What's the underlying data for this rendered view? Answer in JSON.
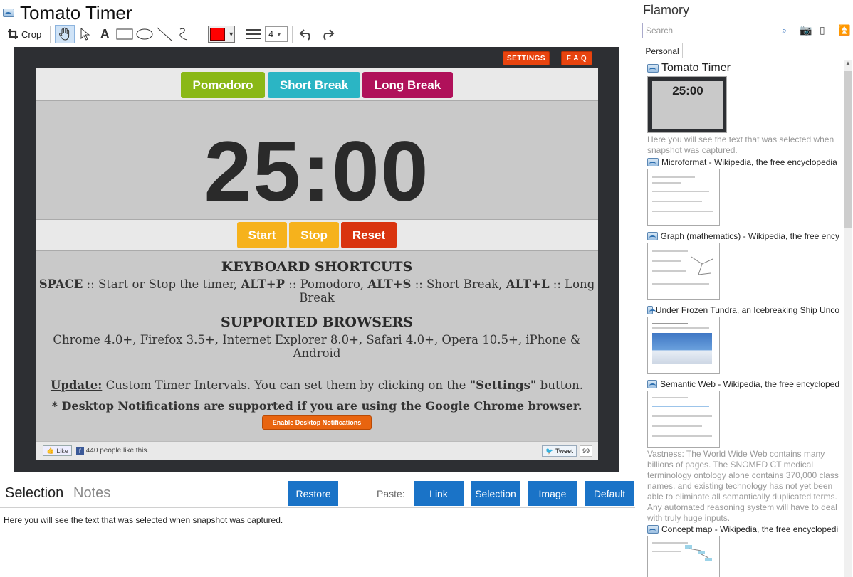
{
  "app": {
    "title": "Tomato Timer"
  },
  "toolbar": {
    "crop_label": "Crop",
    "line_width": "4",
    "color": "#ff0000"
  },
  "snapshot": {
    "settings_label": "SETTINGS",
    "faq_label": "F A Q",
    "modes": [
      "Pomodoro",
      "Short Break",
      "Long Break"
    ],
    "mode_colors": [
      "#8ab817",
      "#2bb5c4",
      "#b0115a"
    ],
    "time": "25:00",
    "controls": [
      "Start",
      "Stop",
      "Reset"
    ],
    "control_colors": [
      "#f6b21c",
      "#f6b21c",
      "#d9340f"
    ],
    "shortcuts_heading": "KEYBOARD SHORTCUTS",
    "shortcuts": [
      {
        "key": "SPACE",
        "desc": " :: Start or Stop the timer, "
      },
      {
        "key": "ALT+P",
        "desc": " :: Pomodoro, "
      },
      {
        "key": "ALT+S",
        "desc": " :: Short Break, "
      },
      {
        "key": "ALT+L",
        "desc": " :: Long Break"
      }
    ],
    "browsers_heading": "SUPPORTED BROWSERS",
    "browsers_text": "Chrome 4.0+, Firefox 3.5+, Internet Explorer 8.0+, Safari 4.0+, Opera 10.5+, iPhone & Android",
    "update_label": "Update:",
    "update_text": " Custom Timer Intervals. You can set them by clicking on the ",
    "update_settings": "\"Settings\"",
    "update_end": " button.",
    "notif_text": "* Desktop Notifications are supported if you are using the Google Chrome browser.",
    "notif_button": "Enable Desktop Notifications",
    "like_label": "Like",
    "like_count_text": "440 people like this.",
    "tweet_label": "Tweet",
    "tweet_count": "99"
  },
  "bottom": {
    "tabs": [
      "Selection",
      "Notes"
    ],
    "restore_label": "Restore",
    "paste_label": "Paste:",
    "paste_buttons": [
      "Link",
      "Selection",
      "Image",
      "Default"
    ],
    "selection_text": "Here you will see the text that was selected when snapshot was captured."
  },
  "sidebar": {
    "app_name": "Flamory",
    "search_placeholder": "Search",
    "tab": "Personal",
    "items": [
      {
        "title": "Tomato Timer",
        "desc": "Here you will see the text that was selected when snapshot was captured."
      },
      {
        "title": "Microformat - Wikipedia, the free encyclopedia",
        "desc": ""
      },
      {
        "title": "Graph (mathematics) - Wikipedia, the free ency",
        "desc": ""
      },
      {
        "title": "Under Frozen Tundra, an Icebreaking Ship Unco",
        "desc": ""
      },
      {
        "title": "Semantic Web - Wikipedia, the free encycloped",
        "desc": "Vastness: The World Wide Web contains many billions of pages. The SNOMED CT medical terminology ontology alone contains 370,000 class names, and existing technology has not yet been able to eliminate all semantically duplicated terms. Any automated reasoning system will have to deal with truly huge inputs."
      },
      {
        "title": "Concept map - Wikipedia, the free encyclopedi",
        "desc": ""
      }
    ]
  }
}
